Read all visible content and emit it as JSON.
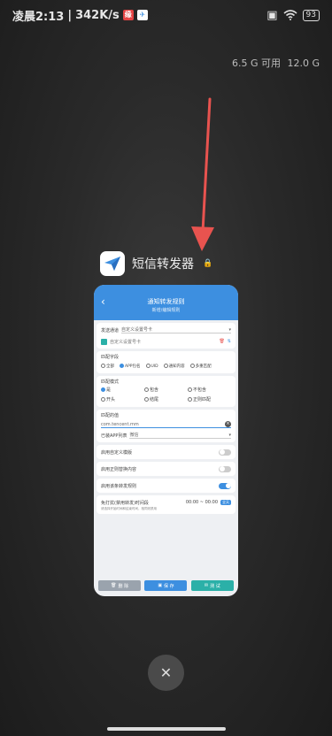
{
  "status": {
    "time": "凌晨2:13",
    "separator": "|",
    "speed": "342K/s",
    "battery": "93"
  },
  "memory": {
    "available": "6.5 G 可用",
    "total": "12.0 G"
  },
  "app": {
    "name": "短信转发器"
  },
  "card": {
    "title": "通知转发规则",
    "subtitle": "新增/编辑规则",
    "sender_label": "发送通道",
    "sender_value": "自定义设置号卡",
    "sender_chip": "自定义设置号卡",
    "match_field_label": "匹配字段",
    "match_fields": [
      "全部",
      "APP包名",
      "UID",
      "通知内容",
      "多重匹配"
    ],
    "match_type_label": "匹配模式",
    "match_types": [
      "是",
      "包含",
      "不包含",
      "开头",
      "结尾",
      "正则匹配"
    ],
    "match_value_label": "匹配的值",
    "match_value": "com.tencent.mm",
    "app_list_label": "已装APP列表",
    "app_list_value": "微信",
    "toggle1": "启用自定义模版",
    "toggle2": "启用正则替换内容",
    "toggle3": "启用该条转发规则",
    "silent_label": "免打扰(禁用转发)时间段",
    "silent_hint": "请选择开始时间和结束时间，相同则禁用",
    "silent_time": "00:00 ~ 00:00",
    "silent_pill": "全天",
    "btn_delete": "删 除",
    "btn_save": "保 存",
    "btn_test": "测 试"
  },
  "colors": {
    "accent": "#3d8fe0",
    "arrow": "#e8534f",
    "save": "#3d8fe0",
    "test": "#2bb0a8",
    "delete": "#9aa3ad"
  }
}
